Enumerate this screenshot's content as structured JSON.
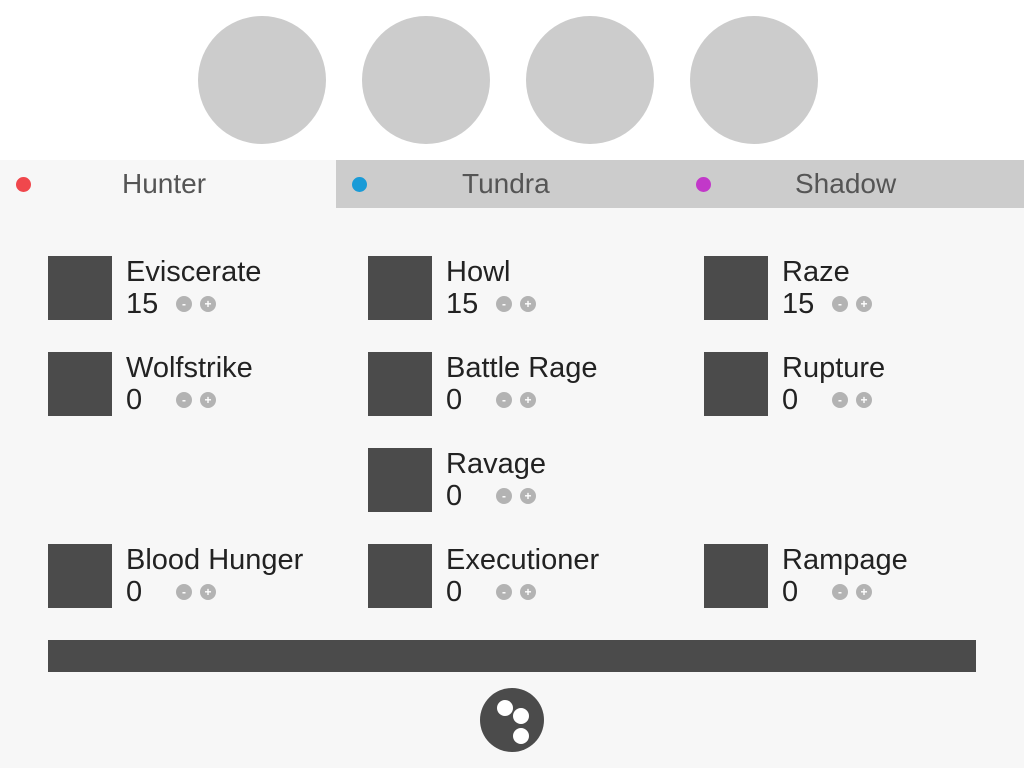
{
  "slots": [
    {
      "name": "slot-1"
    },
    {
      "name": "slot-2"
    },
    {
      "name": "slot-3"
    },
    {
      "name": "slot-4"
    }
  ],
  "tabs": [
    {
      "label": "Hunter",
      "dot_color": "#f0474c",
      "active": true
    },
    {
      "label": "Tundra",
      "dot_color": "#1a9bd7",
      "active": false
    },
    {
      "label": "Shadow",
      "dot_color": "#c238c9",
      "active": false
    }
  ],
  "columns": [
    {
      "talents": [
        {
          "name": "Eviscerate",
          "rank": "15",
          "minus": "-",
          "plus": "+"
        },
        {
          "name": "Wolfstrike",
          "rank": "0",
          "minus": "-",
          "plus": "+"
        },
        {
          "name": "Blood Hunger",
          "rank": "0",
          "minus": "-",
          "plus": "+"
        }
      ]
    },
    {
      "talents": [
        {
          "name": "Howl",
          "rank": "15",
          "minus": "-",
          "plus": "+"
        },
        {
          "name": "Battle Rage",
          "rank": "0",
          "minus": "-",
          "plus": "+"
        },
        {
          "name": "Ravage",
          "rank": "0",
          "minus": "-",
          "plus": "+"
        },
        {
          "name": "Executioner",
          "rank": "0",
          "minus": "-",
          "plus": "+"
        }
      ]
    },
    {
      "talents": [
        {
          "name": "Raze",
          "rank": "15",
          "minus": "-",
          "plus": "+"
        },
        {
          "name": "Rupture",
          "rank": "0",
          "minus": "-",
          "plus": "+"
        },
        {
          "name": "Rampage",
          "rank": "0",
          "minus": "-",
          "plus": "+"
        }
      ]
    }
  ],
  "progress": {
    "fraction": 1.0,
    "color": "#4b4b4b"
  },
  "action_button": {
    "icon": "dice-icon"
  }
}
